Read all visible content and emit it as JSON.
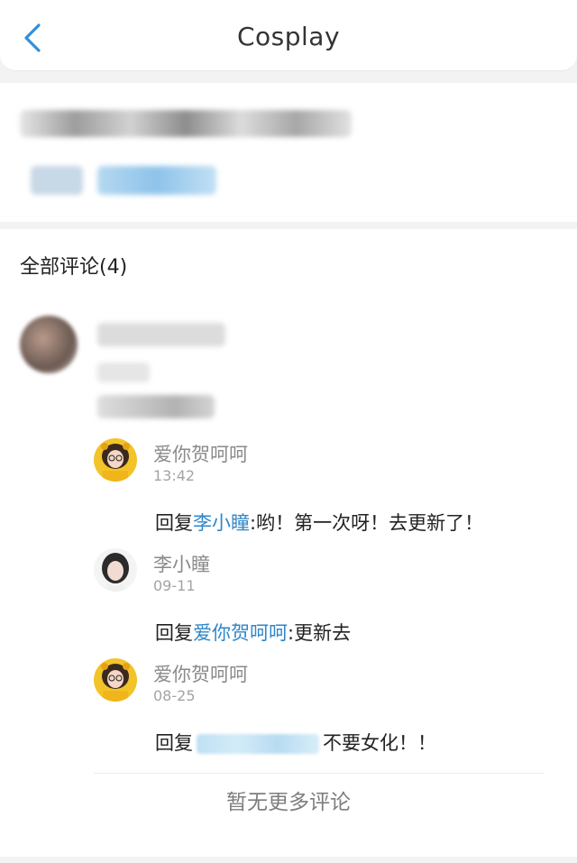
{
  "header": {
    "title": "Cosplay"
  },
  "comments": {
    "section_title": "全部评论(4)",
    "replies": [
      {
        "name": "爱你贺呵呵",
        "time": "13:42",
        "prefix": "回复",
        "mention": "李小瞳",
        "body": ":哟！第一次呀！去更新了！"
      },
      {
        "name": "李小瞳",
        "time": "09-11",
        "prefix": "回复",
        "mention": "爱你贺呵呵",
        "body": ":更新去"
      },
      {
        "name": "爱你贺呵呵",
        "time": "08-25",
        "prefix": "回复",
        "body": "不要女化！！"
      }
    ],
    "no_more": "暂无更多评论"
  }
}
